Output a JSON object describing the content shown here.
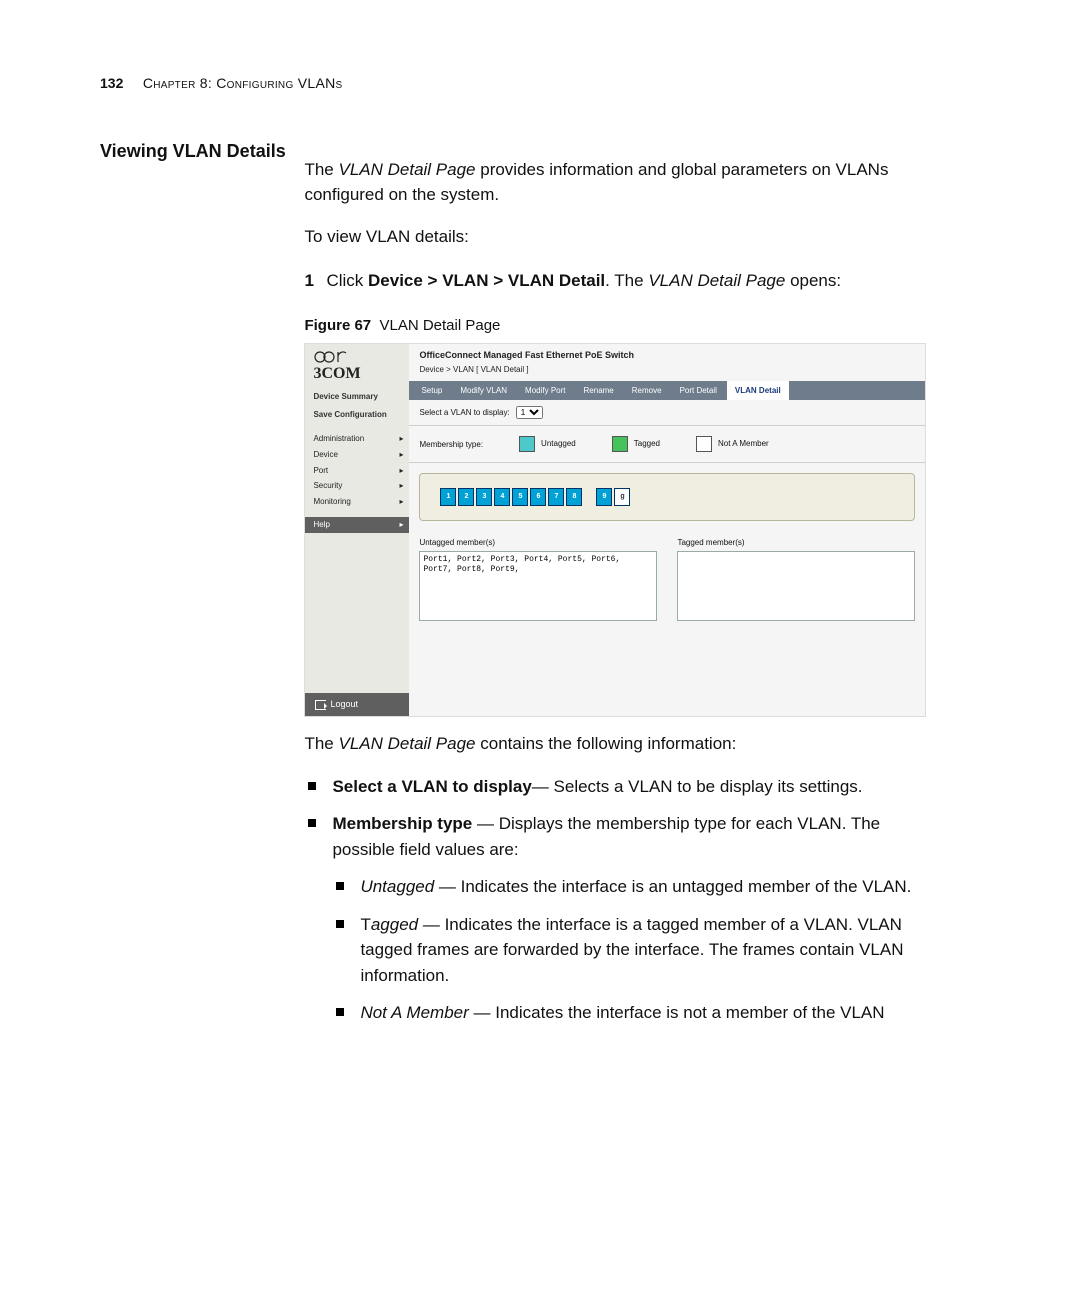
{
  "page_number": "132",
  "chapter_line": "Chapter 8: Configuring VLANs",
  "section_heading": "Viewing VLAN Details",
  "intro1a": "The ",
  "intro1b": "VLAN Detail Page",
  "intro1c": " provides information and global parameters on VLANs configured on the system.",
  "intro2": "To view VLAN details:",
  "step1a": "Click ",
  "step1b": "Device > VLAN > VLAN Detail",
  "step1c": ". The ",
  "step1d": "VLAN Detail Page",
  "step1e": " opens:",
  "fig_num": "Figure 67",
  "fig_title": "VLAN Detail Page",
  "shot": {
    "brand": "3COM",
    "app_title": "OfficeConnect Managed Fast Ethernet PoE Switch",
    "breadcrumb": "Device > VLAN [ VLAN Detail ]",
    "side_links": [
      "Device Summary",
      "Save Configuration"
    ],
    "side_menu": [
      "Administration",
      "Device",
      "Port",
      "Security",
      "Monitoring"
    ],
    "side_help": "Help",
    "logout": "Logout",
    "tabs": [
      "Setup",
      "Modify VLAN",
      "Modify Port",
      "Rename",
      "Remove",
      "Port Detail",
      "VLAN Detail"
    ],
    "select_label": "Select a VLAN to display:",
    "select_value": "1",
    "membership_label": "Membership type:",
    "legend": [
      "Untagged",
      "Tagged",
      "Not A Member"
    ],
    "ports": [
      "1",
      "2",
      "3",
      "4",
      "5",
      "6",
      "7",
      "8",
      "9",
      "g"
    ],
    "untagged_label": "Untagged member(s)",
    "tagged_label": "Tagged member(s)",
    "untagged_value": "Port1, Port2, Port3, Port4, Port5, Port6, Port7, Port8, Port9,",
    "tagged_value": ""
  },
  "after_fig": "The VLAN Detail Page contains the following information:",
  "after_fig_i": "VLAN Detail Page",
  "after_fig_pre": "The ",
  "after_fig_post": " contains the following information:",
  "b_select_h": "Select a VLAN to display",
  "b_select_t": "— Selects a VLAN to be display its settings.",
  "b_mem_h": "Membership type",
  "b_mem_t": " — Displays the membership type for each VLAN. The possible field values are:",
  "b_unt_h": "Untagged",
  "b_unt_t": " — Indicates the interface is an untagged member of the VLAN.",
  "b_tag_h": "Tagged",
  "b_tag_t": " — Indicates the interface is a tagged member of a VLAN. VLAN tagged frames are forwarded by the interface. The frames contain VLAN information.",
  "b_nam_h": "Not A Member",
  "b_nam_t": " — Indicates the interface is not a member of the VLAN"
}
